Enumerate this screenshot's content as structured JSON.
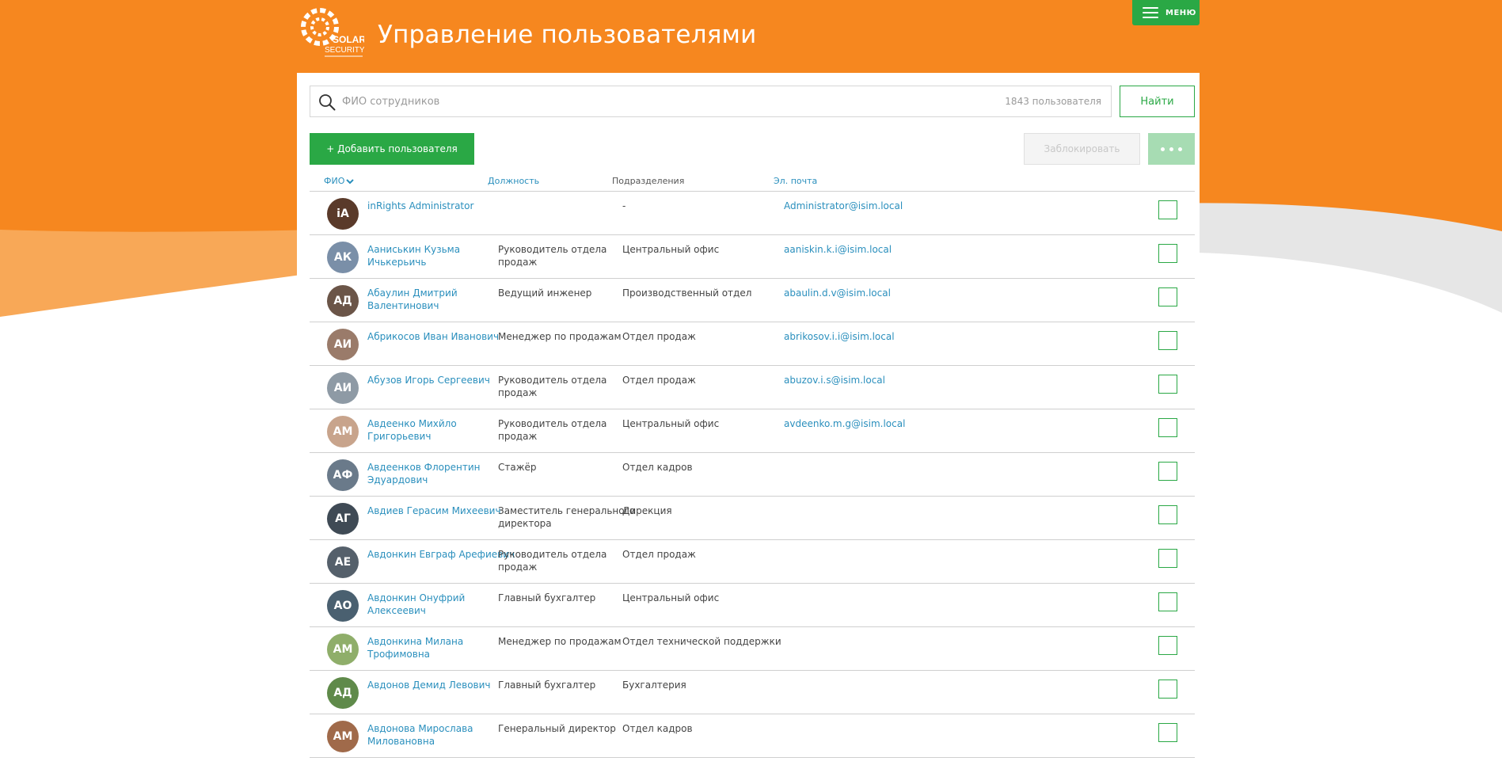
{
  "colors": {
    "brand_orange": "#f6871f",
    "accent_green": "#2aa845",
    "link_blue": "#2a8fbd"
  },
  "header": {
    "logo_text": [
      "SOLAR",
      "SECURITY"
    ],
    "title": "Управление пользователями",
    "menu_label": "МЕНЮ",
    "menu_icon": "hamburger-icon"
  },
  "search": {
    "icon": "search-icon",
    "placeholder": "ФИО сотрудников",
    "value": "",
    "count_text": "1843 пользователя",
    "button_label": "Найти"
  },
  "actions": {
    "add_label": "+ Добавить пользователя",
    "block_label": "Заблокировать",
    "more_icon": "more-dots-icon"
  },
  "table": {
    "columns": {
      "name": "ФИО",
      "position": "Должность",
      "department": "Подразделения",
      "email": "Эл. почта"
    },
    "rows": [
      {
        "initials": "iA",
        "avatar_color": "#5a3a2a",
        "name": "inRights Administrator",
        "position": "",
        "department": "-",
        "email": "Administrator@isim.local"
      },
      {
        "initials": "АК",
        "avatar_color": "#7a8fa8",
        "name": "Ааниськин Кузьма Ичькерьичь",
        "position": "Руководитель отдела продаж",
        "department": "Центральный офис",
        "email": "aaniskin.k.i@isim.local"
      },
      {
        "initials": "АД",
        "avatar_color": "#6b5548",
        "name": "Абаулин Дмитрий Валентинович",
        "position": "Ведущий инженер",
        "department": "Производственный отдел",
        "email": "abaulin.d.v@isim.local"
      },
      {
        "initials": "АИ",
        "avatar_color": "#9a7b6a",
        "name": "Абрикосов Иван Иванович",
        "position": "Менеджер по продажам",
        "department": "Отдел продаж",
        "email": "abrikosov.i.i@isim.local"
      },
      {
        "initials": "АИ",
        "avatar_color": "#8e9aa5",
        "name": "Абузов Игорь Сергеевич",
        "position": "Руководитель отдела продаж",
        "department": "Отдел продаж",
        "email": "abuzov.i.s@isim.local"
      },
      {
        "initials": "АМ",
        "avatar_color": "#c8a48c",
        "name": "Авдеенко Михйло Григорьевич",
        "position": "Руководитель отдела продаж",
        "department": "Центральный офис",
        "email": "avdeenko.m.g@isim.local"
      },
      {
        "initials": "АФ",
        "avatar_color": "#6a7a8a",
        "name": "Авдеенков Флорентин Эдуардович",
        "position": "Стажёр",
        "department": "Отдел кадров",
        "email": ""
      },
      {
        "initials": "АГ",
        "avatar_color": "#3f4a55",
        "name": "Авдиев Герасим Михеевич",
        "position": "Заместитель генерального директора",
        "department": "Дирекция",
        "email": ""
      },
      {
        "initials": "АЕ",
        "avatar_color": "#55606b",
        "name": "Авдонкин Евграф Арефиевич",
        "position": "Руководитель отдела продаж",
        "department": "Отдел продаж",
        "email": ""
      },
      {
        "initials": "АО",
        "avatar_color": "#4a6070",
        "name": "Авдонкин Онуфрий Алексеевич",
        "position": "Главный бухгалтер",
        "department": "Центральный офис",
        "email": ""
      },
      {
        "initials": "АМ",
        "avatar_color": "#8fae6a",
        "name": "Авдонкина Милана Трофимовна",
        "position": "Менеджер по продажам",
        "department": "Отдел технической поддержки",
        "email": ""
      },
      {
        "initials": "АД",
        "avatar_color": "#5f8a4a",
        "name": "Авдонов Демид Левович",
        "position": "Главный бухгалтер",
        "department": "Бухгалтерия",
        "email": ""
      },
      {
        "initials": "АМ",
        "avatar_color": "#a06a4a",
        "name": "Авдонова Мирослава Миловановна",
        "position": "Генеральный директор",
        "department": "Отдел кадров",
        "email": ""
      }
    ]
  }
}
